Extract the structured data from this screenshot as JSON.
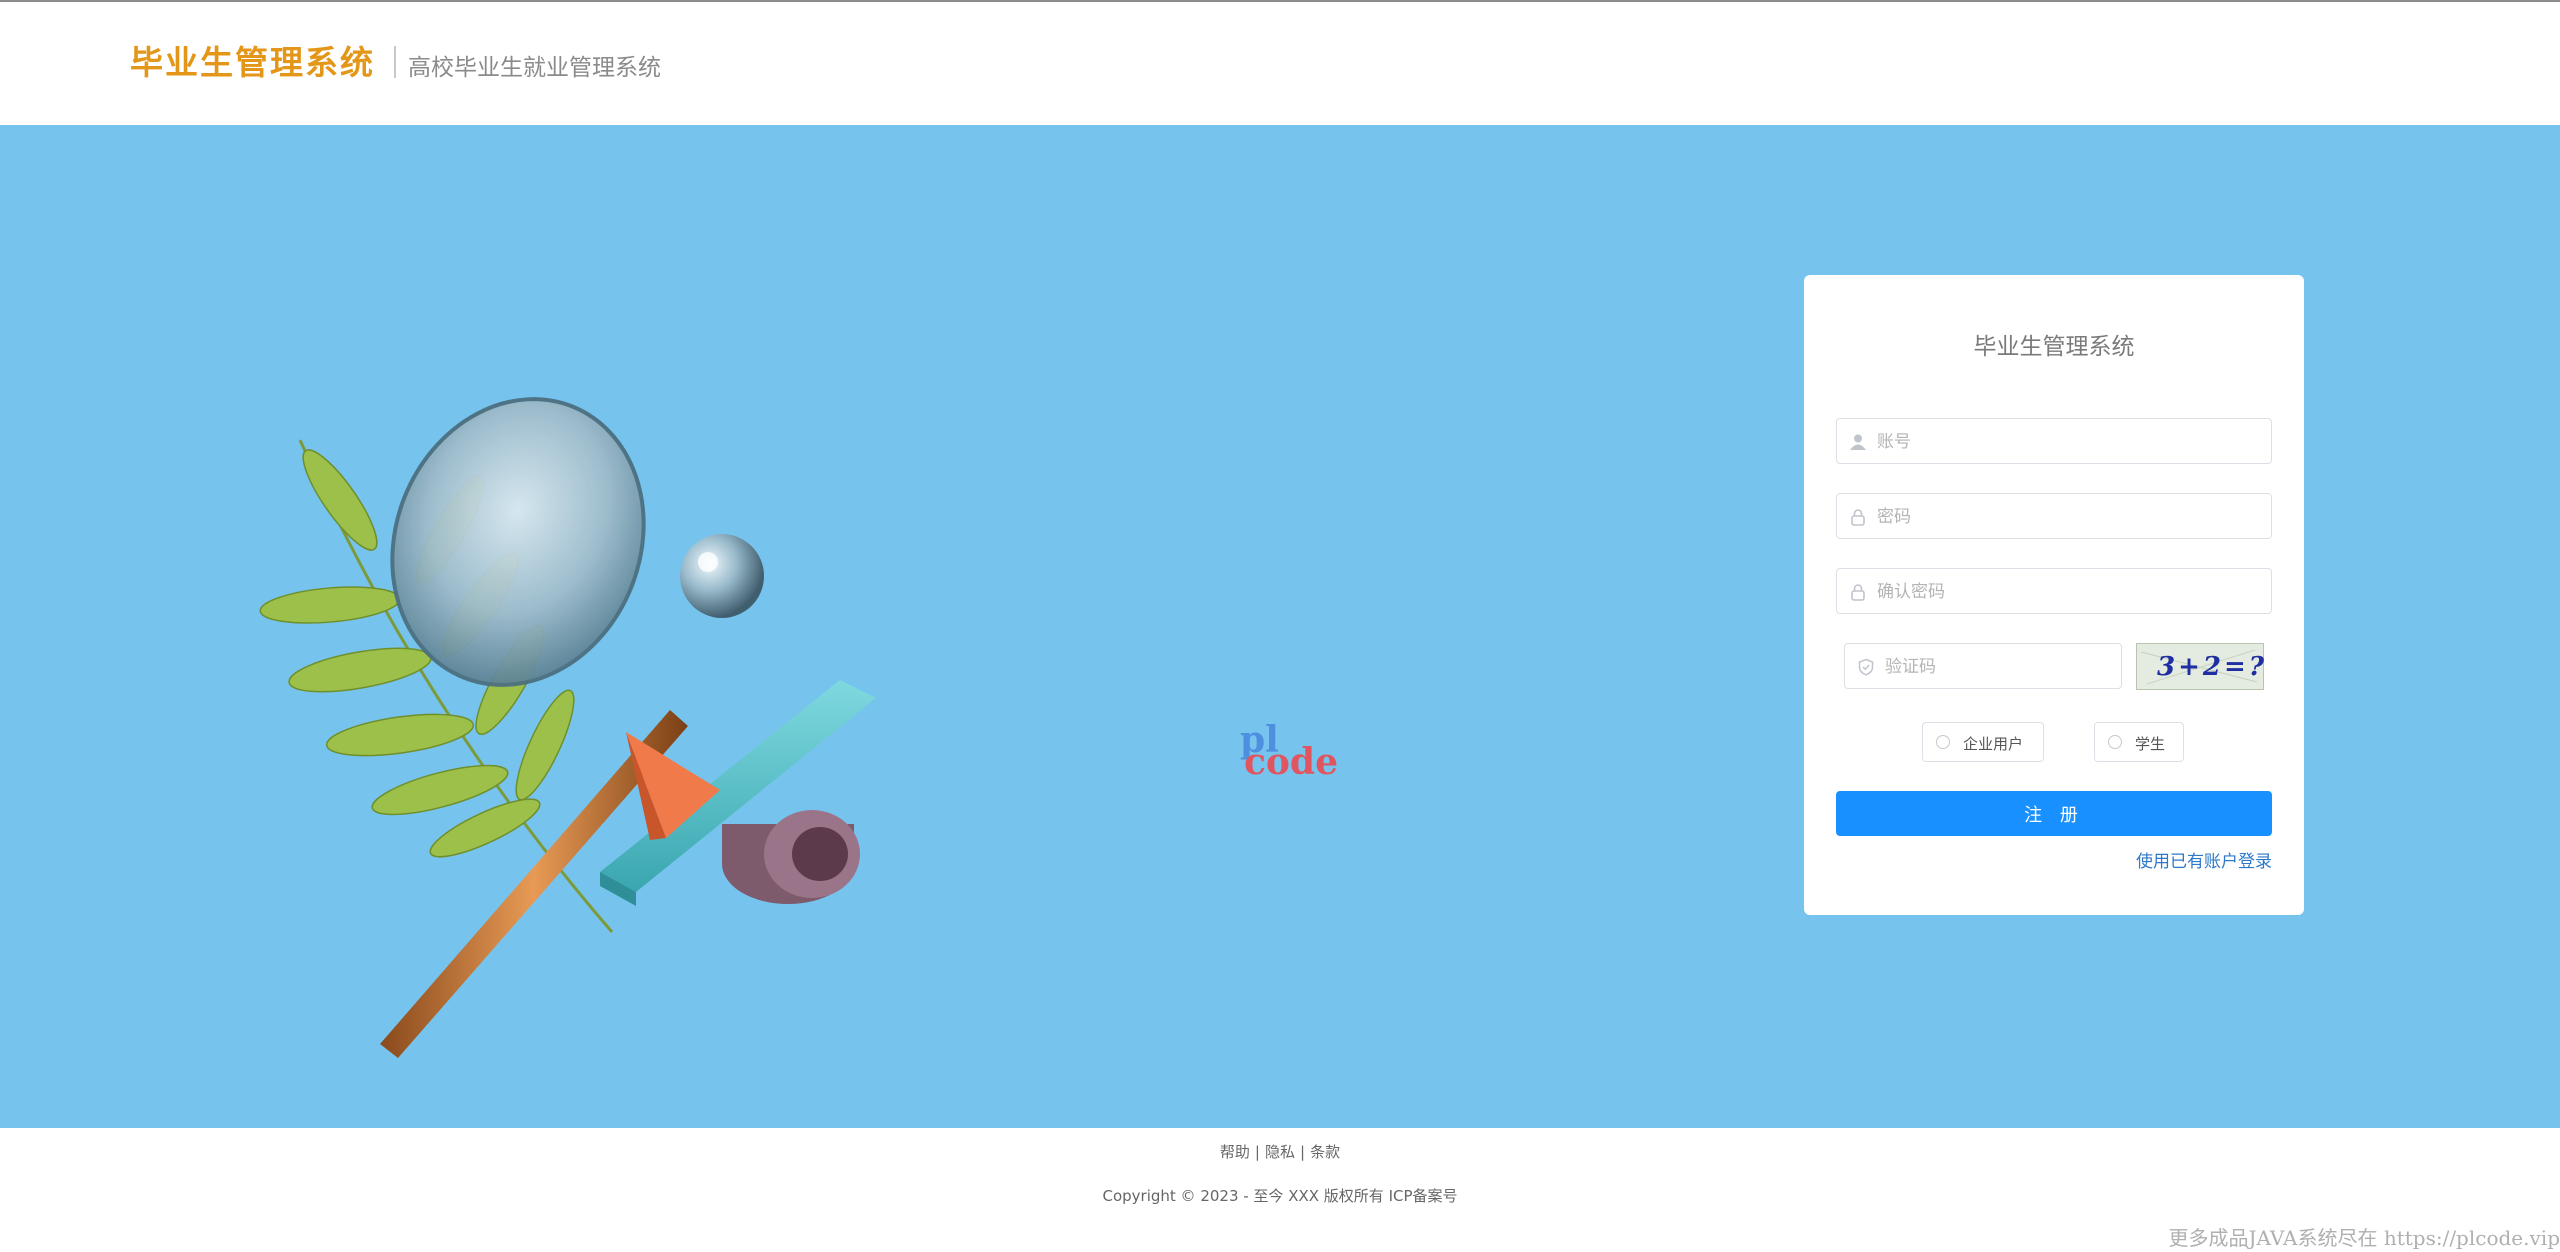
{
  "header": {
    "brand": "毕业生管理系统",
    "subtitle": "高校毕业生就业管理系统"
  },
  "banner": {
    "background_color": "#76c4ee",
    "watermark_logo": {
      "top_text": "pl",
      "bottom_text": "code"
    }
  },
  "form": {
    "title": "毕业生管理系统",
    "account": {
      "placeholder": "账号",
      "value": "",
      "icon": "user-icon"
    },
    "password": {
      "placeholder": "密码",
      "value": "",
      "icon": "lock-icon"
    },
    "confirm_password": {
      "placeholder": "确认密码",
      "value": "",
      "icon": "lock-icon"
    },
    "captcha": {
      "placeholder": "验证码",
      "value": "",
      "icon": "shield-icon",
      "image_text": "3+2=?"
    },
    "roles": [
      {
        "label": "企业用户",
        "selected": false
      },
      {
        "label": "学生",
        "selected": false
      }
    ],
    "submit_label": "注 册",
    "login_link": "使用已有账户登录",
    "accent_color": "#1890ff"
  },
  "footer": {
    "links": [
      "帮助",
      "隐私",
      "条款"
    ],
    "separator": "|",
    "copyright": "Copyright © 2023 - 至今 XXX 版权所有 ICP备案号"
  },
  "site_watermark": "更多成品JAVA系统尽在 https://plcode.vip"
}
